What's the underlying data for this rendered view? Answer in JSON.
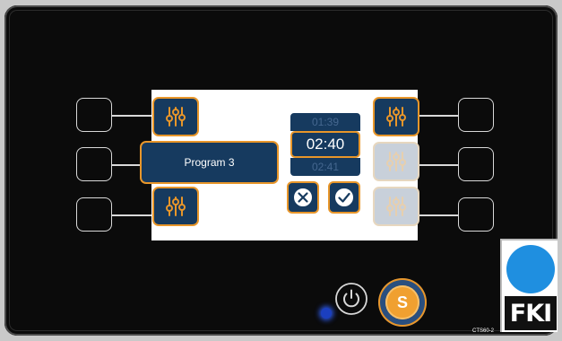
{
  "program": {
    "label": "Program 3"
  },
  "time_picker": {
    "previous": "01:39",
    "current": "02:40",
    "next": "02:41"
  },
  "buttons": {
    "s_label": "S"
  },
  "branding": {
    "logo_text": "FKI",
    "model": "CTS60-2"
  },
  "colors": {
    "tile_background": "#163a5f",
    "tile_border": "#e8962a",
    "bezel": "#0b0b0b",
    "logo_blue": "#1f8fe0",
    "status_led": "#1b3fbf"
  },
  "icons": {
    "settings_tile": "sliders-icon",
    "cancel": "x-circle-icon",
    "confirm": "check-circle-icon",
    "power": "power-icon"
  }
}
